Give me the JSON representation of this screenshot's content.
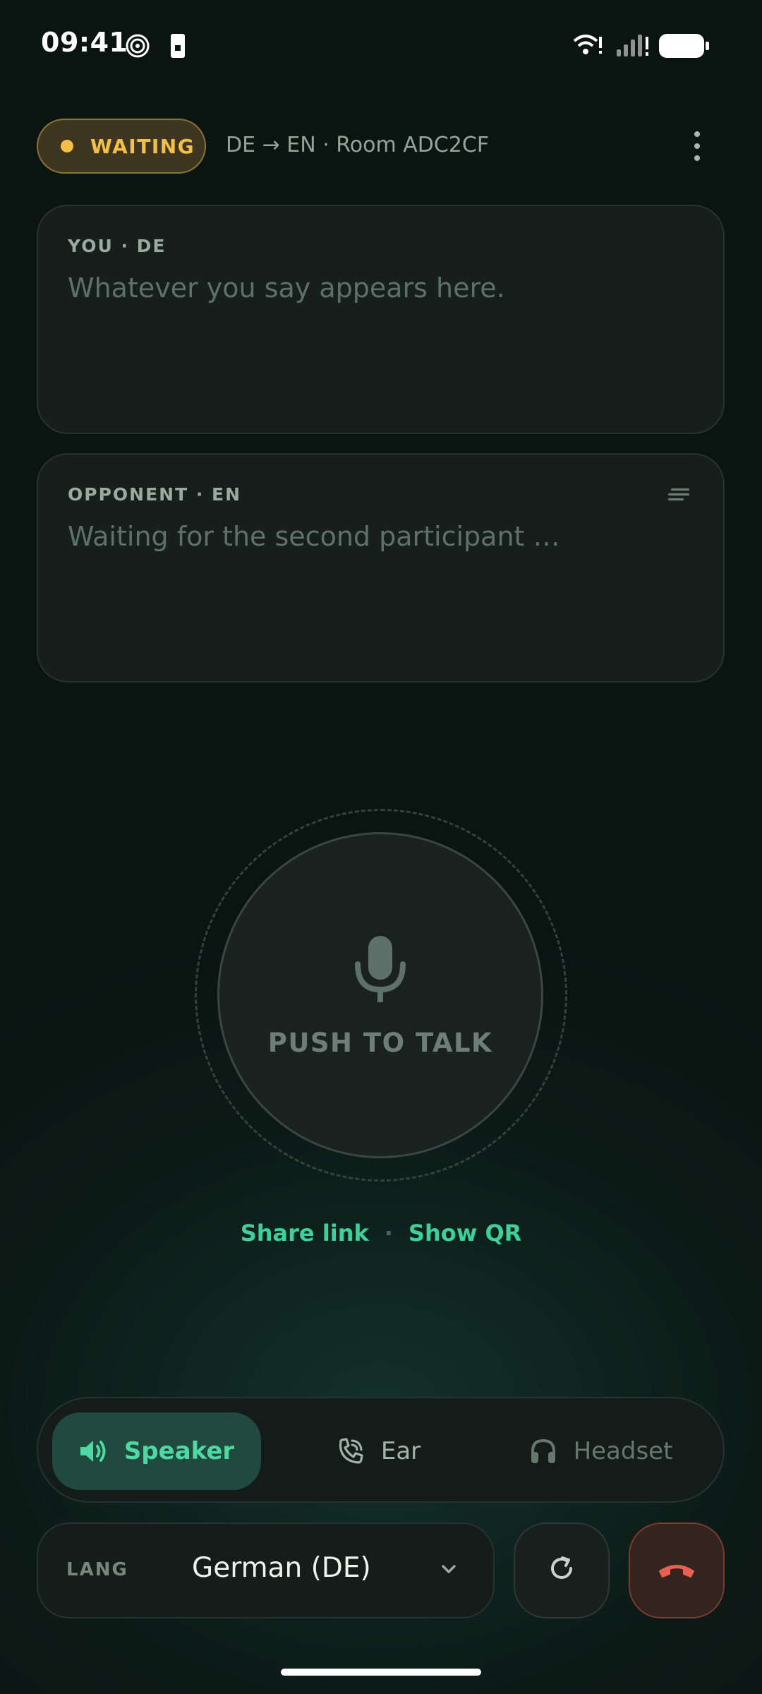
{
  "status_bar": {
    "time": "09:41",
    "left_icons": [
      "spiral-icon",
      "sim-card-icon"
    ],
    "right_icons": [
      "wifi-icon",
      "signal-icon",
      "battery-icon"
    ]
  },
  "header": {
    "status_badge": "WAITING",
    "info": "DE → EN · Room ADC2CF",
    "menu_icon": "more-vert-icon"
  },
  "transcripts": {
    "you": {
      "label": "YOU · DE",
      "placeholder": "Whatever you say appears here."
    },
    "opponent": {
      "label": "OPPONENT · EN",
      "placeholder": "Waiting for the second participant …",
      "icon": "text-lines-icon"
    }
  },
  "ptt": {
    "label": "PUSH TO TALK",
    "icon": "microphone-icon"
  },
  "share": {
    "share_link": "Share link",
    "separator": "·",
    "show_qr": "Show QR"
  },
  "audio_route": {
    "selected": "Speaker",
    "options": [
      {
        "label": "Speaker",
        "icon": "speaker-icon"
      },
      {
        "label": "Ear",
        "icon": "phone-ear-icon"
      },
      {
        "label": "Headset",
        "icon": "headset-icon"
      }
    ]
  },
  "language": {
    "label": "LANG",
    "value": "German (DE)"
  },
  "colors": {
    "accent": "#3fcf9a",
    "waiting": "#f2bf48",
    "hangup": "#e8604f",
    "background": "#0b1512"
  }
}
